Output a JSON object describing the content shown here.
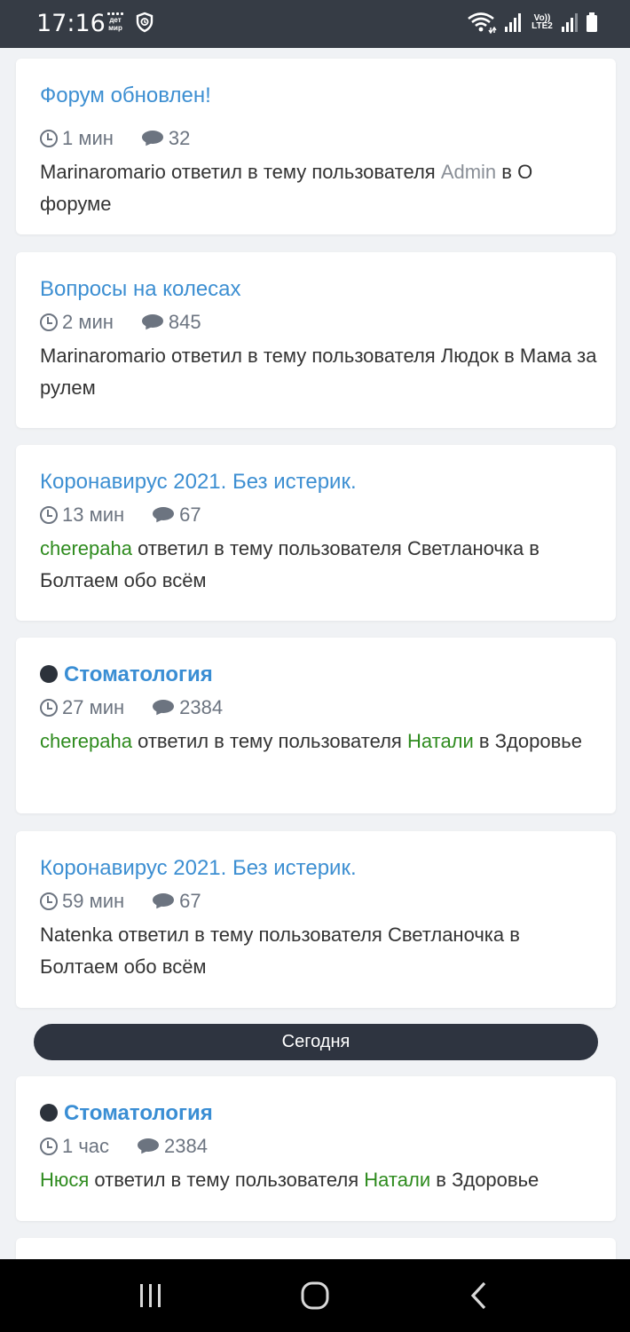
{
  "status_bar": {
    "time": "17:16",
    "carrier_badge_line1": "дет",
    "carrier_badge_line2": "мир",
    "network_label_line1": "Vo))",
    "network_label_line2": "LTE2",
    "icons": [
      "grid-app-icon",
      "shield-icon",
      "wifi-icon",
      "signal-icon",
      "battery-icon"
    ]
  },
  "feed": [
    {
      "title": "Форум обновлен!",
      "pinned": false,
      "time": "1 мин",
      "comments": "32",
      "author": "Marinaromario",
      "action": " ответил в тему пользователя ",
      "topic_user": "Admin",
      "in_word": " в ",
      "forum": "О форуме"
    },
    {
      "title": "Вопросы на колесах",
      "pinned": false,
      "time": "2 мин",
      "comments": "845",
      "author": "Marinaromario",
      "action": " ответил в тему пользователя ",
      "topic_user": "Людок",
      "in_word": " в ",
      "forum": "Мама за рулем"
    },
    {
      "title": "Коронавирус 2021. Без истерик.",
      "pinned": false,
      "time": "13 мин",
      "comments": "67",
      "author": "cherepaha",
      "action": " ответил в тему пользователя ",
      "topic_user": "Светланочка",
      "in_word": " в ",
      "forum": "Болтаем обо всём"
    },
    {
      "title": "Стоматология",
      "pinned": true,
      "time": "27 мин",
      "comments": "2384",
      "author": "cherepaha",
      "action": " ответил в тему пользователя ",
      "topic_user": "Натали",
      "in_word": " в ",
      "forum": "Здоровье"
    },
    {
      "title": "Коронавирус 2021. Без истерик.",
      "pinned": false,
      "time": "59 мин",
      "comments": "67",
      "author": "Natenka",
      "action": " ответил в тему пользователя ",
      "topic_user": "Светланочка",
      "in_word": " в ",
      "forum": "Болтаем обо всём"
    }
  ],
  "divider_label": "Сегодня",
  "feed_today": [
    {
      "title": "Стоматология",
      "pinned": true,
      "time": "1 час",
      "comments": "2384",
      "author": "Нюся",
      "action": " ответил в тему пользователя ",
      "topic_user": "Натали",
      "in_word": " в ",
      "forum": "Здоровье"
    }
  ],
  "colors": {
    "title_link": "#3d8fd2",
    "green_user": "#2e8b1e",
    "gray_user": "#8a8f97",
    "status_bar_bg": "#363c45",
    "divider_bg": "#2e3440"
  },
  "nav_bar": {
    "icons": [
      "recent-apps-icon",
      "home-icon",
      "back-icon"
    ]
  }
}
